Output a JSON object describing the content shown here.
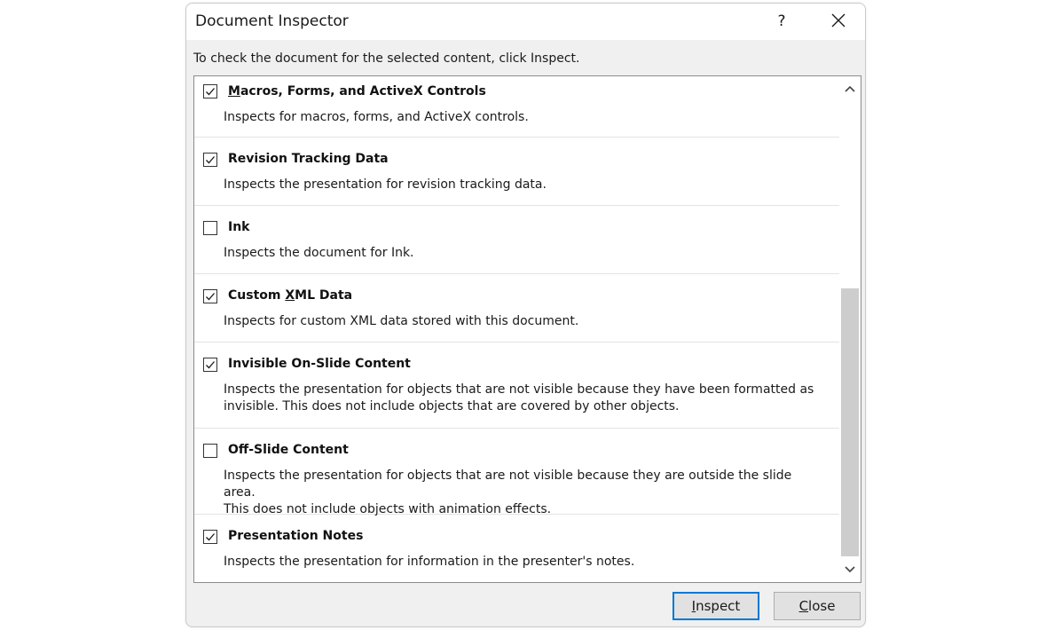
{
  "window": {
    "title": "Document Inspector",
    "help_label": "?",
    "close_icon": "close-icon"
  },
  "instruction": "To check the document for the selected content, click Inspect.",
  "items": [
    {
      "title": "Macros, Forms, and ActiveX Controls",
      "description": "Inspects for macros, forms, and ActiveX controls.",
      "checked": true
    },
    {
      "title": "Revision Tracking Data",
      "description": "Inspects the presentation for revision tracking data.",
      "checked": true
    },
    {
      "title": "Ink",
      "description": "Inspects the document for Ink.",
      "checked": false
    },
    {
      "title": "Custom XML Data",
      "description": "Inspects for custom XML data stored with this document.",
      "checked": true
    },
    {
      "title": "Invisible On-Slide Content",
      "description": "Inspects the presentation for objects that are not visible because they have been formatted as\ninvisible. This does not include objects that are covered by other objects.",
      "checked": true
    },
    {
      "title": "Off-Slide Content",
      "description": "Inspects the presentation for objects that are not visible because they are outside the slide area.\nThis does not include objects with animation effects.",
      "checked": false
    },
    {
      "title": "Presentation Notes",
      "description": "Inspects the presentation for information in the presenter's notes.",
      "checked": true
    }
  ],
  "buttons": {
    "inspect_label": "Inspect",
    "close_label": "Close"
  },
  "colors": {
    "default_button_border": "#0078d4",
    "dialog_background": "#f0f0f0",
    "scroll_thumb": "#cdcdcd"
  }
}
